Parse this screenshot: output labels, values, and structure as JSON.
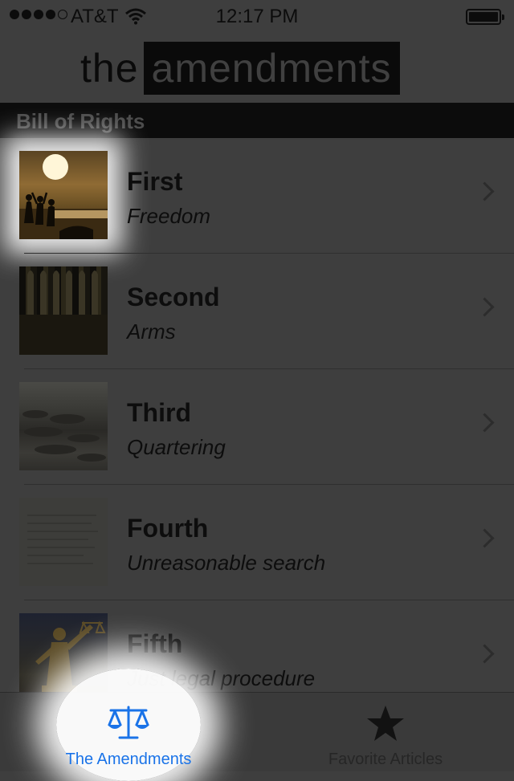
{
  "status_bar": {
    "carrier": "AT&T",
    "time": "12:17 PM",
    "signal_bars": 4,
    "signal_total": 5
  },
  "header": {
    "logo_word1": "the",
    "logo_word2": "amendments"
  },
  "section": {
    "title": "Bill of Rights"
  },
  "rows": [
    {
      "title": "First",
      "subtitle": "Freedom",
      "icon": "freedom-thumbnail"
    },
    {
      "title": "Second",
      "subtitle": "Arms",
      "icon": "arms-thumbnail"
    },
    {
      "title": "Third",
      "subtitle": "Quartering",
      "icon": "quartering-thumbnail"
    },
    {
      "title": "Fourth",
      "subtitle": "Unreasonable search",
      "icon": "search-thumbnail"
    },
    {
      "title": "Fifth",
      "subtitle": "Just legal procedure",
      "icon": "justice-thumbnail"
    }
  ],
  "tab_bar": {
    "tabs": [
      {
        "label": "The Amendments",
        "icon": "scales-icon",
        "selected": true
      },
      {
        "label": "Favorite Articles",
        "icon": "star-icon",
        "selected": false
      }
    ]
  },
  "colors": {
    "accent": "#1a73e8",
    "background": "#3e3e3e",
    "section_bar": "#0c0c0c"
  }
}
